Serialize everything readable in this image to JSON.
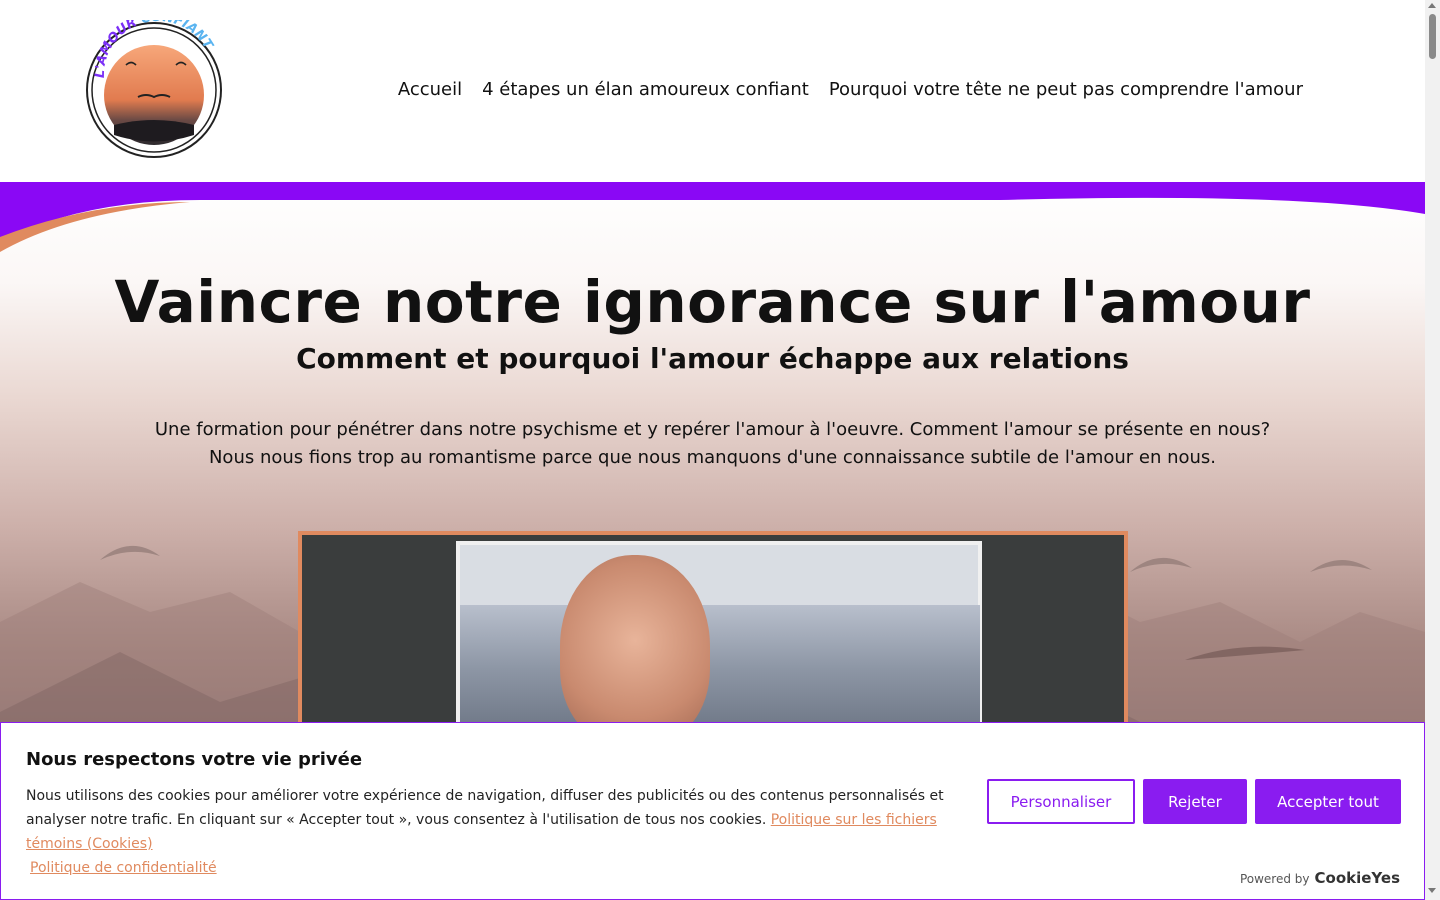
{
  "header": {
    "logo_text": "L'AMOUR CONFIANT",
    "nav": [
      {
        "label": "Accueil"
      },
      {
        "label": "4 étapes un élan amoureux confiant"
      },
      {
        "label": "Pourquoi votre tête ne peut pas comprendre l'amour"
      }
    ]
  },
  "hero": {
    "title": "Vaincre notre ignorance sur l'amour",
    "subtitle": "Comment et pourquoi l'amour échappe aux relations",
    "description_line1": "Une formation pour pénétrer dans notre psychisme et y repérer l'amour à l'oeuvre. Comment l'amour se présente en nous?",
    "description_line2": "Nous nous fions trop au romantisme parce que nous manquons d'une connaissance subtile de l'amour en nous."
  },
  "cookie_banner": {
    "title": "Nous respectons votre vie privée",
    "text": "Nous utilisons des cookies pour améliorer votre expérience de navigation, diffuser des publicités ou des contenus personnalisés et analyser notre trafic. En cliquant sur « Accepter tout », vous consentez à l'utilisation de tous nos cookies.",
    "cookie_policy_link": "Politique sur les fichiers témoins (Cookies)",
    "privacy_link": "Politique de confidentialité",
    "customize_label": "Personnaliser",
    "reject_label": "Rejeter",
    "accept_label": "Accepter tout",
    "powered_by": "Powered by",
    "brand": "CookieYes"
  },
  "colors": {
    "accent": "#8a1cf0",
    "orange": "#e08a5f"
  }
}
